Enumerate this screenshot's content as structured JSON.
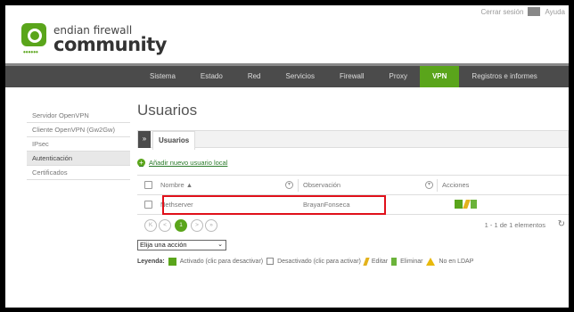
{
  "header": {
    "logo_line1": "endian firewall",
    "logo_line2": "community",
    "logo_dots": "••••••",
    "logout": "Cerrar sesión",
    "help": "Ayuda"
  },
  "nav": {
    "items": [
      "Sistema",
      "Estado",
      "Red",
      "Servicios",
      "Firewall",
      "Proxy",
      "VPN",
      "Registros e informes"
    ],
    "active": "VPN"
  },
  "sidebar": {
    "items": [
      "Servidor OpenVPN",
      "Cliente OpenVPN (Gw2Gw)",
      "IPsec",
      "Autenticación",
      "Certificados"
    ],
    "active": "Autenticación"
  },
  "main": {
    "title": "Usuarios",
    "tab_toggle": "»",
    "tab": "Usuarios",
    "add_link": "Añadir nuevo usuario local",
    "columns": [
      "Nombre ▲",
      "Observación",
      "Acciones"
    ],
    "rows": [
      {
        "name": "Nethserver",
        "note": "BrayanFonseca"
      }
    ],
    "pager": {
      "first": "K",
      "prev": "<",
      "current": "1",
      "next": ">",
      "last": "»",
      "info": "1 - 1 de 1 elementos",
      "refresh": "↻"
    },
    "action_select": "Elija una acción",
    "legend": {
      "label": "Leyenda:",
      "active": "Activado (clic para desactivar)",
      "inactive": "Desactivado (clic para activar)",
      "edit": "Editar",
      "delete": "Eliminar",
      "ldap": "No en LDAP"
    }
  },
  "colors": {
    "brand": "#5aa51b",
    "nav_bg": "#4b4b4b",
    "highlight": "#e0101a"
  }
}
